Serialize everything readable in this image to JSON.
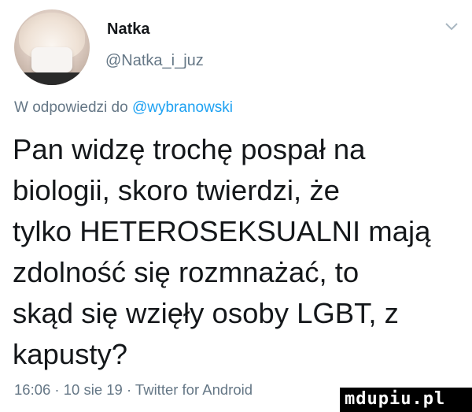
{
  "author": {
    "avatar_icon": "user-avatar",
    "name": "Natka",
    "handle": "@Natka_i_juz"
  },
  "menu_icon": "chevron-down-icon",
  "reply_context": {
    "prefix": "W odpowiedzi do ",
    "mention": "@wybranowski"
  },
  "tweet": {
    "lines": [
      "Pan widzę trochę pospał na",
      "biologii, skoro twierdzi, że",
      "tylko HETEROSEKSUALNI mają",
      "zdolność się rozmnażać, to",
      "skąd się wzięły osoby LGBT, z",
      "kapusty?"
    ]
  },
  "meta": {
    "text": "16:06 · 10 sie 19 · Twitter for Android"
  },
  "watermark": {
    "text": "mdupiu.pl"
  },
  "colors": {
    "text": "#14171a",
    "secondary": "#657786",
    "link": "#1da1f2",
    "background": "#ffffff"
  }
}
